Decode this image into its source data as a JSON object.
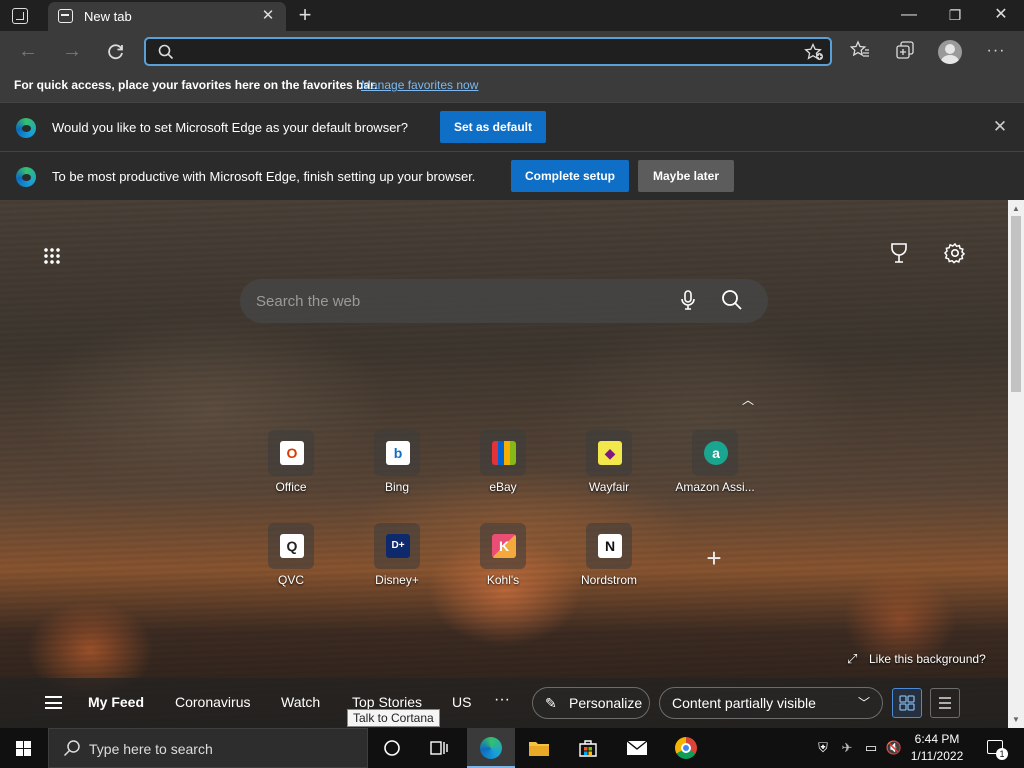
{
  "tabs": [
    {
      "title": "New tab"
    }
  ],
  "window_controls": {
    "minimize": "—",
    "maximize": "❐",
    "close": "✕"
  },
  "address_bar": {
    "value": "",
    "placeholder": ""
  },
  "favorites_bar": {
    "message": "For quick access, place your favorites here on the favorites bar.",
    "link": "Manage favorites now"
  },
  "infobars": [
    {
      "text": "Would you like to set Microsoft Edge as your default browser?",
      "primary": "Set as default"
    },
    {
      "text": "To be most productive with Microsoft Edge, finish setting up your browser.",
      "primary": "Complete setup",
      "secondary": "Maybe later"
    }
  ],
  "ntp": {
    "search_placeholder": "Search the web",
    "tiles": [
      {
        "label": "Office",
        "logo": "O",
        "color": "#d83b01",
        "bg": "#ffffff"
      },
      {
        "label": "Bing",
        "logo": "b",
        "color": "#0f6fc6",
        "bg": "#ffffff"
      },
      {
        "label": "eBay",
        "logo": "▮",
        "color": "#e53238",
        "bg": "#222222"
      },
      {
        "label": "Wayfair",
        "logo": "◆",
        "color": "#7f187f",
        "bg": "#f2e74b"
      },
      {
        "label": "Amazon Assi...",
        "logo": "a",
        "color": "#ffffff",
        "bg": "#1aa590"
      },
      {
        "label": "QVC",
        "logo": "Q",
        "color": "#222222",
        "bg": "#ffffff"
      },
      {
        "label": "Disney+",
        "logo": "D+",
        "color": "#ffffff",
        "bg": "#0e2a6d"
      },
      {
        "label": "Kohl's",
        "logo": "K",
        "color": "#ffffff",
        "bg": "#9b3a8c"
      },
      {
        "label": "Nordstrom",
        "logo": "N",
        "color": "#111111",
        "bg": "#ffffff"
      }
    ],
    "like_background": "Like this background?",
    "feed": {
      "items": [
        "My Feed",
        "Coronavirus",
        "Watch",
        "Top Stories",
        "US",
        "···"
      ],
      "personalize": "Personalize",
      "content_visibility": "Content partially visible"
    }
  },
  "taskbar": {
    "search_placeholder": "Type here to search",
    "time": "6:44 PM",
    "date": "1/11/2022",
    "notifications": "1"
  },
  "tooltip": "Talk to Cortana",
  "colors": {
    "accent": "#0f6fc6",
    "address_focus": "#5aa0d8",
    "link": "#7bb8ef"
  }
}
